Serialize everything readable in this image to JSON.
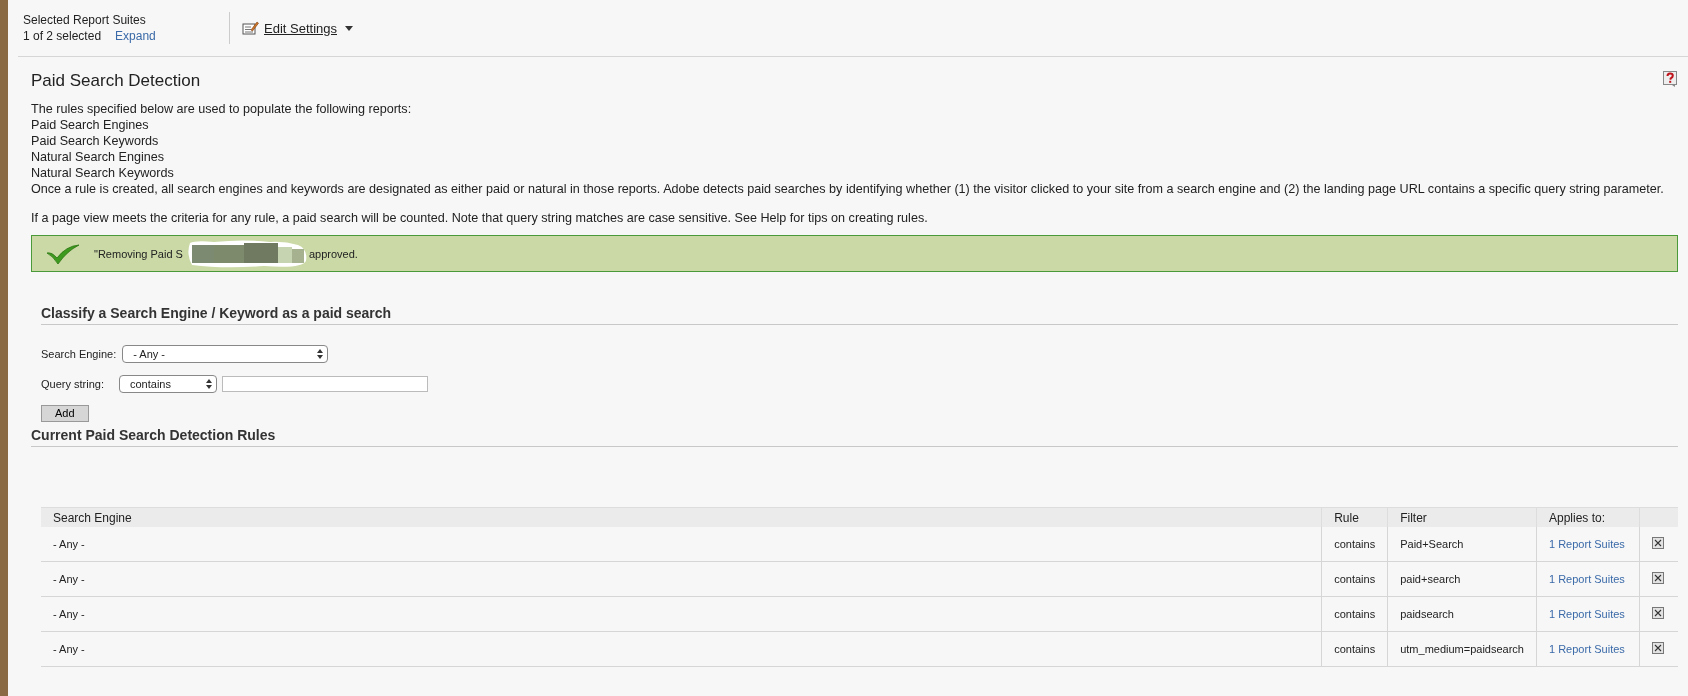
{
  "header": {
    "suites_label": "Selected Report Suites",
    "selected_count": "1 of 2 selected",
    "expand_link": "Expand",
    "edit_settings": "Edit Settings"
  },
  "page": {
    "title": "Paid Search Detection",
    "intro": [
      "The rules specified below are used to populate the following reports:",
      "Paid Search Engines",
      "Paid Search Keywords",
      "Natural Search Engines",
      "Natural Search Keywords",
      "Once a rule is created, all search engines and keywords are designated as either paid or natural in those reports. Adobe detects paid searches by identifying whether (1) the visitor clicked to your site from a search engine and (2) the landing page URL contains a specific query string parameter."
    ],
    "note": "If a page view meets the criteria for any rule, a paid search will be counted. Note that query string matches are case sensitive. See Help for tips on creating rules.",
    "banner": {
      "text_before": "\"Removing Paid S",
      "text_after": "approved."
    }
  },
  "classify": {
    "heading": "Classify a Search Engine / Keyword as a paid search",
    "search_engine": {
      "label": "Search Engine:",
      "value": "- Any -"
    },
    "query_string": {
      "label": "Query string:",
      "operator": "contains"
    },
    "add_button": "Add"
  },
  "rules": {
    "heading": "Current Paid Search Detection Rules",
    "columns": [
      "Search Engine",
      "Rule",
      "Filter",
      "Applies to:"
    ],
    "rows": [
      {
        "engine": "- Any -",
        "rule": "contains",
        "filter": "Paid+Search",
        "applies": "1 Report Suites"
      },
      {
        "engine": "- Any -",
        "rule": "contains",
        "filter": "paid+search",
        "applies": "1 Report Suites"
      },
      {
        "engine": "- Any -",
        "rule": "contains",
        "filter": "paidsearch",
        "applies": "1 Report Suites"
      },
      {
        "engine": "- Any -",
        "rule": "contains",
        "filter": "utm_medium=paidsearch",
        "applies": "1 Report Suites"
      }
    ]
  }
}
